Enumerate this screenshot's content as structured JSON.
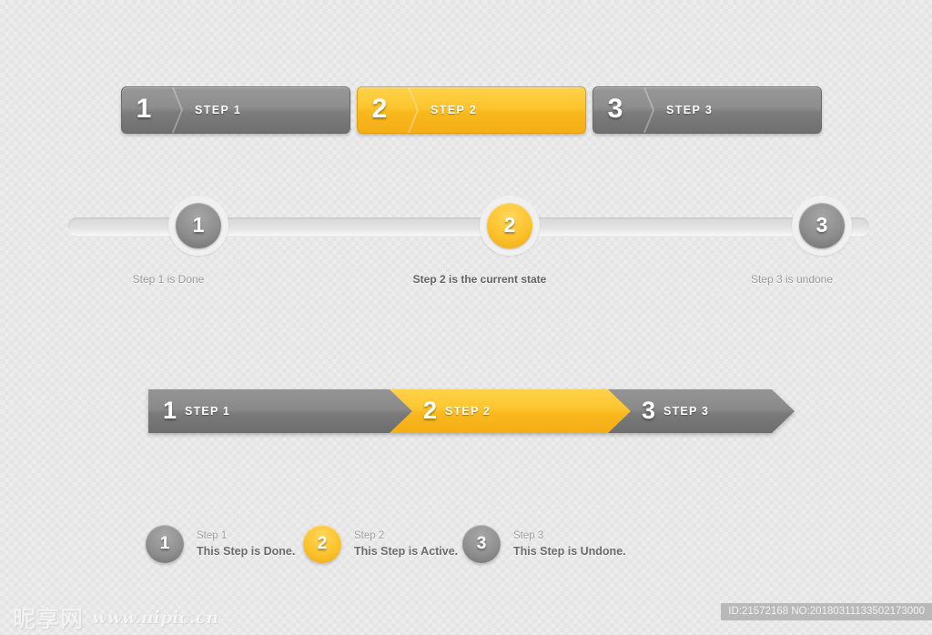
{
  "pill_steps": {
    "items": [
      {
        "number": "1",
        "label": "STEP 1",
        "state": "done"
      },
      {
        "number": "2",
        "label": "STEP 2",
        "state": "active"
      },
      {
        "number": "3",
        "label": "STEP  3",
        "state": "undone"
      }
    ]
  },
  "track_steps": {
    "items": [
      {
        "number": "1",
        "caption": "Step 1 is Done",
        "state": "done"
      },
      {
        "number": "2",
        "caption": "Step 2 is the current state",
        "state": "active"
      },
      {
        "number": "3",
        "caption": "Step 3 is undone",
        "state": "undone"
      }
    ]
  },
  "arrow_steps": {
    "items": [
      {
        "number": "1",
        "label": "STEP 1",
        "state": "done"
      },
      {
        "number": "2",
        "label": "STEP 2",
        "state": "active"
      },
      {
        "number": "3",
        "label": "STEP  3",
        "state": "undone"
      }
    ]
  },
  "legend_steps": {
    "items": [
      {
        "number": "1",
        "title": "Step 1",
        "description": "This Step is Done.",
        "state": "done"
      },
      {
        "number": "2",
        "title": "Step 2",
        "description": "This Step is Active.",
        "state": "active"
      },
      {
        "number": "3",
        "title": "Step 3",
        "description": "This Step is Undone.",
        "state": "undone"
      }
    ]
  },
  "footer": {
    "logo_text": "昵享网",
    "site_url": "www.nipic.cn",
    "id_text": "ID:21572168 NO:20180311133502173000"
  },
  "colors": {
    "accent_yellow": "#fcc52e",
    "gray": "#8a8a8a",
    "background": "#ececec",
    "caption_muted": "#9a9a9a",
    "caption_active": "#636363"
  }
}
